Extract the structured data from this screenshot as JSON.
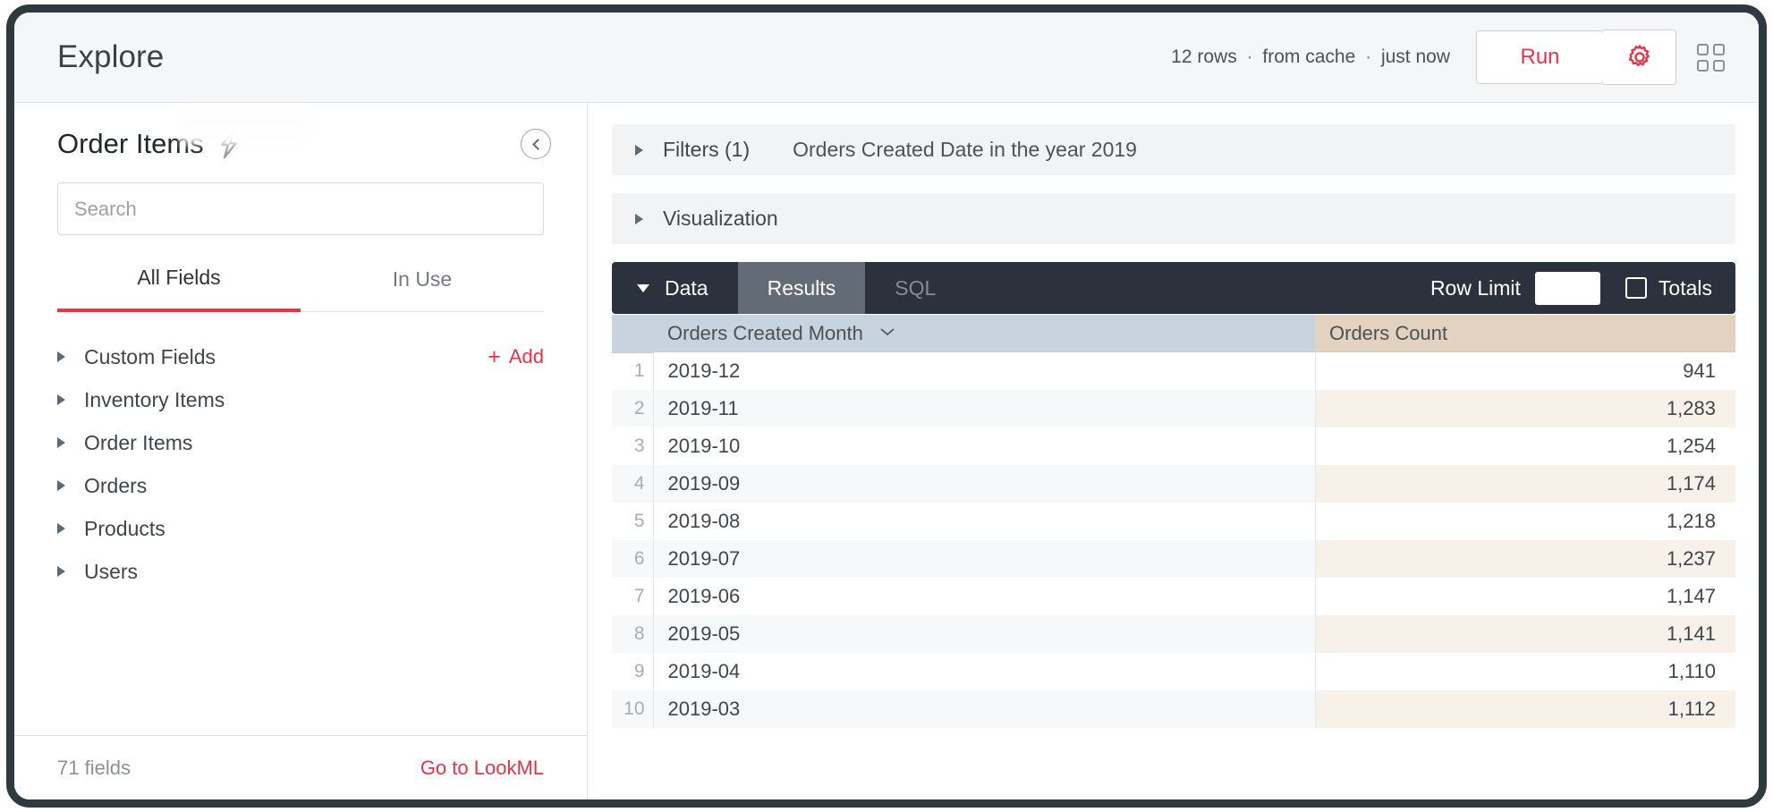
{
  "header": {
    "title": "Explore",
    "status": {
      "rows": "12 rows",
      "source": "from cache",
      "time": "just now",
      "separator": "·"
    },
    "run_label": "Run",
    "gear_icon": "gear-icon",
    "grid_icon": "grid-apps-icon"
  },
  "sidebar": {
    "explore_name": "Order Items",
    "lightning_icon": "lightning-bolt-icon",
    "collapse_icon": "chevron-left-circle-icon",
    "search": {
      "value": "",
      "placeholder": "Search"
    },
    "tabs": [
      {
        "label": "All Fields",
        "active": true
      },
      {
        "label": "In Use",
        "active": false
      }
    ],
    "tree": [
      {
        "label": "Custom Fields",
        "add": {
          "plus": "+",
          "label": "Add"
        }
      },
      {
        "label": "Inventory Items"
      },
      {
        "label": "Order Items"
      },
      {
        "label": "Orders"
      },
      {
        "label": "Products"
      },
      {
        "label": "Users"
      }
    ],
    "footer": {
      "field_count": "71 fields",
      "lookml_link": "Go to LookML"
    }
  },
  "main": {
    "filters": {
      "title": "Filters (1)",
      "summary": "Orders Created Date in the year 2019"
    },
    "visualization": {
      "title": "Visualization"
    },
    "data_bar": {
      "data_label": "Data",
      "tabs": [
        {
          "label": "Results",
          "state": "selected"
        },
        {
          "label": "SQL",
          "state": "muted"
        }
      ],
      "row_limit_label": "Row Limit",
      "row_limit_value": "",
      "totals_label": "Totals",
      "totals_checked": false
    }
  },
  "chart_data": {
    "type": "table",
    "title": "Orders Created Month by Orders Count",
    "columns": [
      {
        "name": "Orders Created Month",
        "kind": "dimension",
        "sort": "desc",
        "sort_icon": "chevron-down"
      },
      {
        "name": "Orders Count",
        "kind": "measure"
      }
    ],
    "categories": [
      "2019-12",
      "2019-11",
      "2019-10",
      "2019-09",
      "2019-08",
      "2019-07",
      "2019-06",
      "2019-05",
      "2019-04",
      "2019-03"
    ],
    "values": [
      941,
      1283,
      1254,
      1174,
      1218,
      1237,
      1147,
      1141,
      1110,
      1112
    ],
    "rows": [
      {
        "n": "1",
        "month": "2019-12",
        "count": "941"
      },
      {
        "n": "2",
        "month": "2019-11",
        "count": "1,283"
      },
      {
        "n": "3",
        "month": "2019-10",
        "count": "1,254"
      },
      {
        "n": "4",
        "month": "2019-09",
        "count": "1,174"
      },
      {
        "n": "5",
        "month": "2019-08",
        "count": "1,218"
      },
      {
        "n": "6",
        "month": "2019-07",
        "count": "1,237"
      },
      {
        "n": "7",
        "month": "2019-06",
        "count": "1,147"
      },
      {
        "n": "8",
        "month": "2019-05",
        "count": "1,141"
      },
      {
        "n": "9",
        "month": "2019-04",
        "count": "1,110"
      },
      {
        "n": "10",
        "month": "2019-03",
        "count": "1,112"
      }
    ]
  },
  "colors": {
    "accent_red": "#e8324a",
    "dark_bar": "#2b313d",
    "dimension_header": "#c7d3df",
    "measure_header": "#e3d2bf",
    "measure_alt_row": "#f8f1ea"
  }
}
